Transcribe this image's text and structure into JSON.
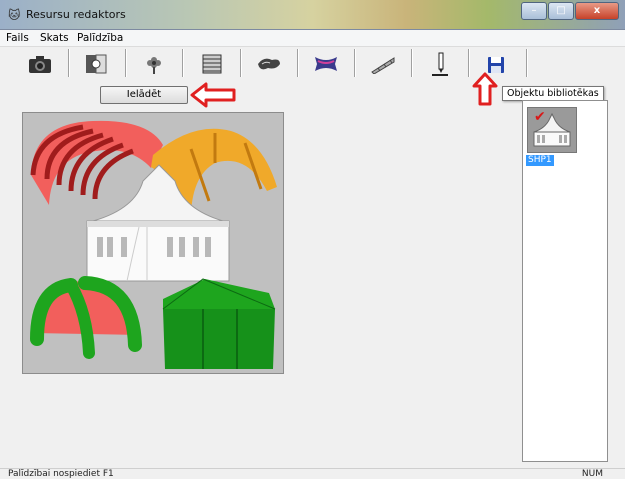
{
  "window": {
    "title": "Resursu redaktors",
    "app_icon": "cat-face-icon",
    "controls": {
      "minimize": "–",
      "maximize": "□",
      "close": "x"
    }
  },
  "menu": [
    "Fails",
    "Skats",
    "Palīdzība"
  ],
  "toolbar": {
    "icons": [
      "camera-icon",
      "light-panel-icon",
      "flower-icon",
      "shutter-icon",
      "animal-icon",
      "rug-icon",
      "ramp-icon",
      "pen-icon",
      "save-icon"
    ]
  },
  "load_button": {
    "label": "Ielādēt"
  },
  "tooltip": {
    "text": "Objektu bibliotēkas"
  },
  "library": {
    "items": [
      {
        "label": "SHP1",
        "checked": true
      }
    ]
  },
  "status": {
    "help": "Palīdzībai nospiediet F1",
    "num": "NUM"
  },
  "colors": {
    "accent": "#3399ff",
    "arrow": "#e02020",
    "tent_red": "#f25f5c",
    "tent_orange": "#f0a92a",
    "tent_green": "#1ea51e"
  }
}
